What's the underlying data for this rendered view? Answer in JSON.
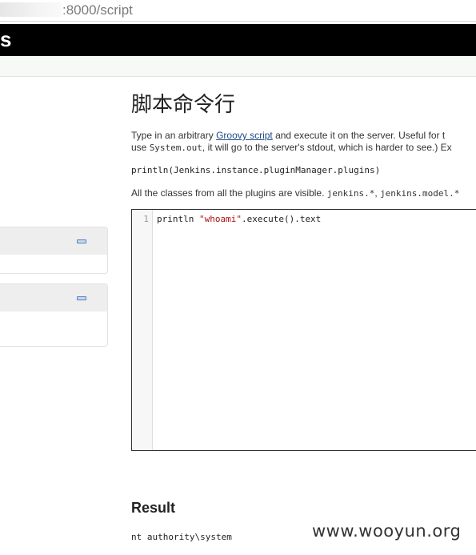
{
  "browser": {
    "url_visible": ":8000/script"
  },
  "header": {
    "logo_text": "s"
  },
  "page": {
    "title": "脚本命令行",
    "description": {
      "line1_prefix": "Type in an arbitrary ",
      "link_text": "Groovy script",
      "line1_suffix": " and execute it on the server. Useful for t",
      "line2_prefix": "use ",
      "line2_code": "System.out",
      "line2_suffix": ", it will go to the server's stdout, which is harder to see.) Ex"
    },
    "example_code": "println(Jenkins.instance.pluginManager.plugins)",
    "classes_line": {
      "text": "All the classes from all the plugins are visible. ",
      "code1": "jenkins.*",
      "sep": ", ",
      "code2": "jenkins.model.*"
    }
  },
  "editor": {
    "line_number": "1",
    "code_prefix": "println ",
    "code_string": "\"whoami\"",
    "code_suffix": ".execute().text"
  },
  "result": {
    "heading": "Result",
    "output": "nt authority\\system"
  },
  "watermark": "www.wooyun.org",
  "colors": {
    "header_bg": "#000000",
    "link": "#204a87",
    "string_literal": "#aa1111"
  }
}
